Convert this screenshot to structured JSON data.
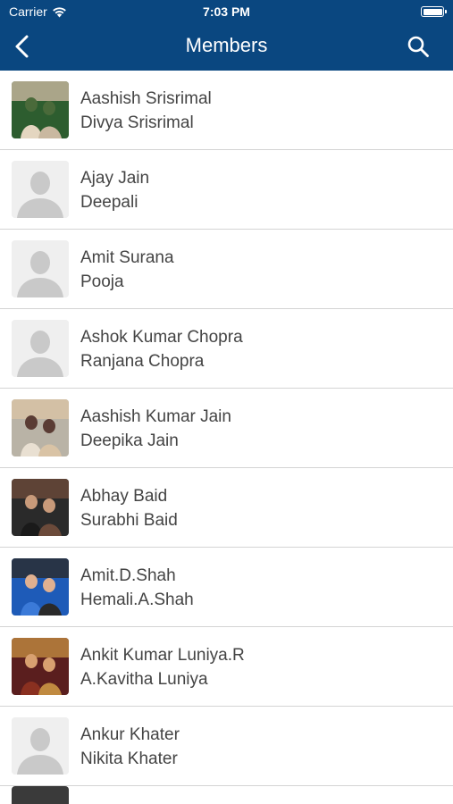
{
  "status": {
    "carrier": "Carrier",
    "time": "7:03 PM"
  },
  "nav": {
    "title": "Members"
  },
  "colors": {
    "nav_bg": "#0a4780",
    "text": "#444444",
    "divider": "#d4d4d4"
  },
  "members": [
    {
      "name": "Aashish Srisrimal",
      "spouse": "Divya Srisrimal",
      "avatar": "photo"
    },
    {
      "name": "Ajay Jain",
      "spouse": "Deepali",
      "avatar": "placeholder"
    },
    {
      "name": "Amit Surana",
      "spouse": "Pooja",
      "avatar": "placeholder"
    },
    {
      "name": "Ashok Kumar Chopra",
      "spouse": "Ranjana Chopra",
      "avatar": "placeholder"
    },
    {
      "name": "Aashish Kumar Jain",
      "spouse": "Deepika Jain",
      "avatar": "photo"
    },
    {
      "name": "Abhay Baid",
      "spouse": "Surabhi Baid",
      "avatar": "photo"
    },
    {
      "name": "Amit.D.Shah",
      "spouse": "Hemali.A.Shah",
      "avatar": "photo"
    },
    {
      "name": "Ankit Kumar Luniya.R",
      "spouse": "A.Kavitha Luniya",
      "avatar": "photo"
    },
    {
      "name": "Ankur Khater",
      "spouse": "Nikita Khater",
      "avatar": "placeholder"
    }
  ]
}
